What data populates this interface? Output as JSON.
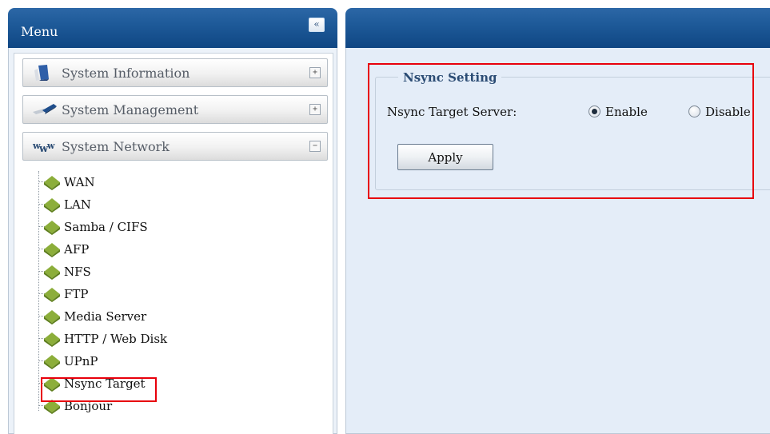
{
  "menu": {
    "title": "Menu",
    "collapse_label": "«",
    "sections": [
      {
        "label": "System Information",
        "toggle": "+",
        "icon": "system-information-icon"
      },
      {
        "label": "System Management",
        "toggle": "+",
        "icon": "system-management-icon"
      },
      {
        "label": "System Network",
        "toggle": "−",
        "icon": "system-network-icon"
      }
    ],
    "network_items": [
      {
        "label": "WAN"
      },
      {
        "label": "LAN"
      },
      {
        "label": "Samba / CIFS"
      },
      {
        "label": "AFP"
      },
      {
        "label": "NFS"
      },
      {
        "label": "FTP"
      },
      {
        "label": "Media Server"
      },
      {
        "label": "HTTP / Web Disk"
      },
      {
        "label": "UPnP"
      },
      {
        "label": "Nsync Target",
        "selected": true
      },
      {
        "label": "Bonjour"
      }
    ]
  },
  "nsync": {
    "legend": "Nsync Setting",
    "target_label": "Nsync Target Server:",
    "options": [
      {
        "label": "Enable",
        "checked": true
      },
      {
        "label": "Disable",
        "checked": false
      }
    ],
    "apply_label": "Apply"
  },
  "colors": {
    "header_blue": "#1e5a99",
    "panel_bg": "#e4edf8",
    "highlight_red": "#e8000b",
    "leaf_green": "#8cae3a"
  }
}
